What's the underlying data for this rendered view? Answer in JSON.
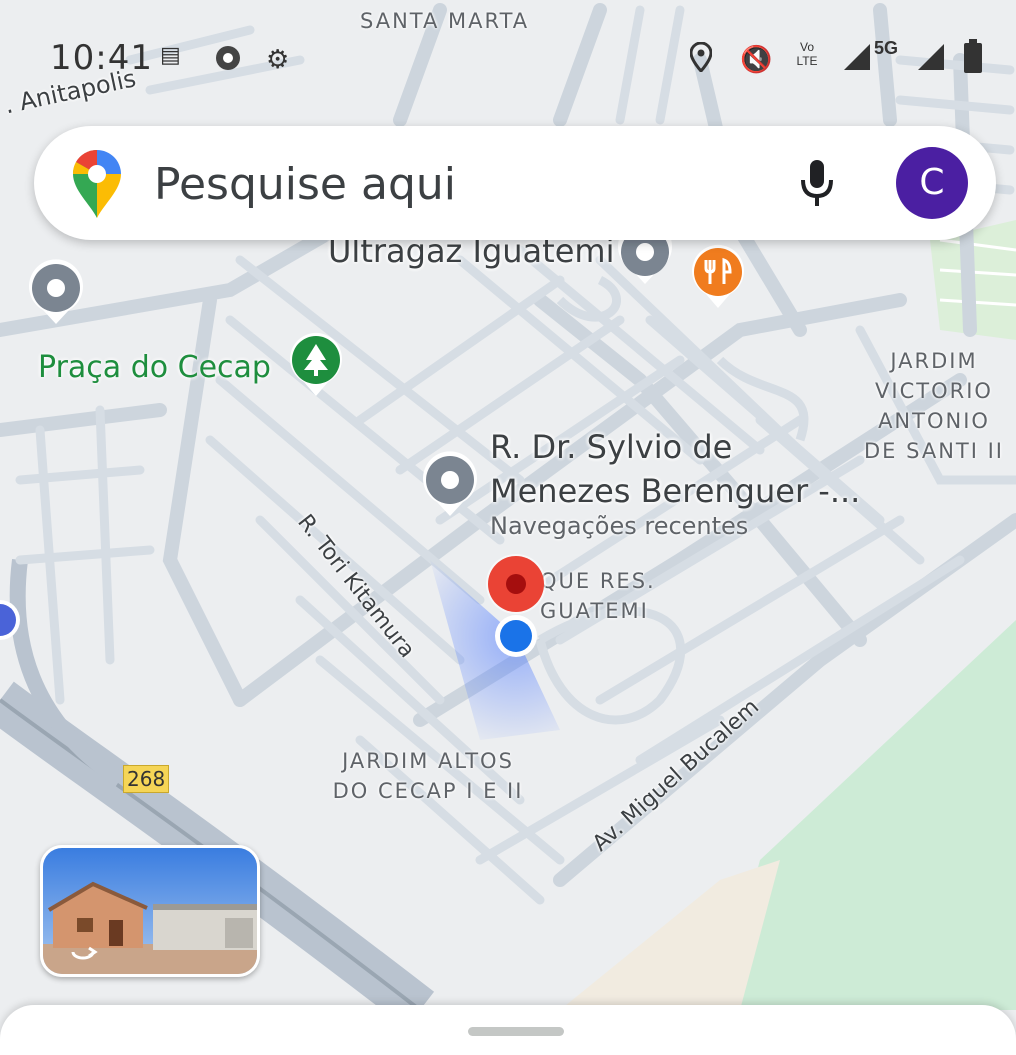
{
  "status_bar": {
    "time": "10:41",
    "icons": [
      "sim-icon",
      "chrome-icon",
      "tools-icon",
      "location-icon",
      "mute-icon",
      "volte-icon",
      "signal-icon",
      "5g-icon",
      "signal-icon",
      "battery-icon"
    ],
    "network_label": "5G",
    "volte_label": "Vo LTE"
  },
  "search": {
    "placeholder": "Pesquise aqui",
    "avatar_letter": "C",
    "avatar_color": "#4b1fa2"
  },
  "map": {
    "area_labels": {
      "santa_marta": "SANTA MARTA",
      "jardim_victorio": [
        "JARDIM",
        "VICTORIO",
        "ANTONIO",
        "DE SANTI II"
      ],
      "parque_iguatemi": [
        "QUE RES.",
        "GUATEMI"
      ],
      "jardim_altos": [
        "JARDIM ALTOS",
        "DO CECAP I E II"
      ]
    },
    "street_labels": {
      "anitapolis": ". Anitapolis",
      "tori": "R. Tori Kitamura",
      "bucalem": "Av. Miguel Bucalem"
    },
    "pois": {
      "ultragaz": "Ultragaz Iguatemi",
      "praca": "Praça do Cecap",
      "recent_title_1": "R. Dr. Sylvio de",
      "recent_title_2": "Menezes Berenguer -...",
      "recent_subtitle": "Navegações recentes"
    },
    "route_number": "268",
    "colors": {
      "park_green": "#1e8e3e",
      "restaurant_orange": "#f07c1e",
      "dropped_pin_red": "#ea4335",
      "my_location_blue": "#1a73e8"
    }
  }
}
